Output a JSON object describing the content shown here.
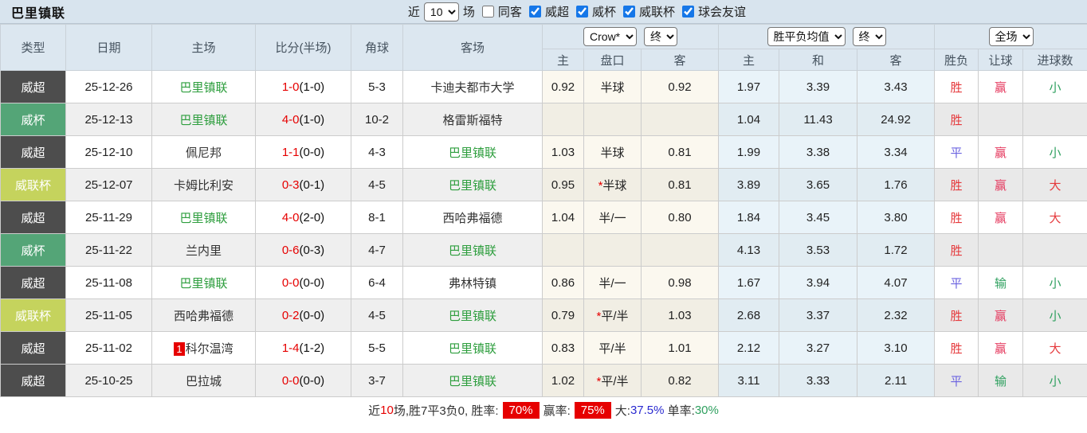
{
  "title": "巴里镇联",
  "filters": {
    "near_label": "近",
    "near_value": "10",
    "games_label": "场",
    "same_opponent": {
      "label": "同客",
      "checked": false
    },
    "leagues": [
      {
        "label": "威超",
        "checked": true
      },
      {
        "label": "威杯",
        "checked": true
      },
      {
        "label": "威联杯",
        "checked": true
      },
      {
        "label": "球会友谊",
        "checked": true
      }
    ]
  },
  "table": {
    "main_headers": [
      "类型",
      "日期",
      "主场",
      "比分(半场)",
      "角球",
      "客场"
    ],
    "group_selects": {
      "ah_company": "Crow*",
      "ah_stage": "终",
      "eu_company": "胜平负均值",
      "eu_stage": "终",
      "scope": "全场"
    },
    "sub_headers": [
      "主",
      "盘口",
      "客",
      "主",
      "和",
      "客",
      "胜负",
      "让球",
      "进球数"
    ],
    "rows": [
      {
        "type": "威超",
        "type_style": "dark",
        "date": "25-12-26",
        "home": "巴里镇联",
        "home_is_team": true,
        "home_rank": "",
        "score": "1-0",
        "half": "(1-0)",
        "corner": "5-3",
        "away": "卡迪夫都市大学",
        "away_is_team": false,
        "ah_home": "0.92",
        "ah_star": false,
        "ah_line": "半球",
        "ah_away": "0.92",
        "odds_home": "1.97",
        "odds_draw": "3.39",
        "odds_away": "3.43",
        "result": "胜",
        "handicap": "赢",
        "goals": "小"
      },
      {
        "type": "威杯",
        "type_style": "green",
        "date": "25-12-13",
        "home": "巴里镇联",
        "home_is_team": true,
        "home_rank": "",
        "score": "4-0",
        "half": "(1-0)",
        "corner": "10-2",
        "away": "格雷斯福特",
        "away_is_team": false,
        "ah_home": "",
        "ah_star": false,
        "ah_line": "",
        "ah_away": "",
        "odds_home": "1.04",
        "odds_draw": "11.43",
        "odds_away": "24.92",
        "result": "胜",
        "handicap": "",
        "goals": ""
      },
      {
        "type": "威超",
        "type_style": "dark",
        "date": "25-12-10",
        "home": "佩尼邦",
        "home_is_team": false,
        "home_rank": "",
        "score": "1-1",
        "half": "(0-0)",
        "corner": "4-3",
        "away": "巴里镇联",
        "away_is_team": true,
        "ah_home": "1.03",
        "ah_star": false,
        "ah_line": "半球",
        "ah_away": "0.81",
        "odds_home": "1.99",
        "odds_draw": "3.38",
        "odds_away": "3.34",
        "result": "平",
        "handicap": "赢",
        "goals": "小"
      },
      {
        "type": "威联杯",
        "type_style": "yellowgreen",
        "date": "25-12-07",
        "home": "卡姆比利安",
        "home_is_team": false,
        "home_rank": "",
        "score": "0-3",
        "half": "(0-1)",
        "corner": "4-5",
        "away": "巴里镇联",
        "away_is_team": true,
        "ah_home": "0.95",
        "ah_star": true,
        "ah_line": "半球",
        "ah_away": "0.81",
        "odds_home": "3.89",
        "odds_draw": "3.65",
        "odds_away": "1.76",
        "result": "胜",
        "handicap": "赢",
        "goals": "大"
      },
      {
        "type": "威超",
        "type_style": "dark",
        "date": "25-11-29",
        "home": "巴里镇联",
        "home_is_team": true,
        "home_rank": "",
        "score": "4-0",
        "half": "(2-0)",
        "corner": "8-1",
        "away": "西哈弗福德",
        "away_is_team": false,
        "ah_home": "1.04",
        "ah_star": false,
        "ah_line": "半/一",
        "ah_away": "0.80",
        "odds_home": "1.84",
        "odds_draw": "3.45",
        "odds_away": "3.80",
        "result": "胜",
        "handicap": "赢",
        "goals": "大"
      },
      {
        "type": "威杯",
        "type_style": "green",
        "date": "25-11-22",
        "home": "兰内里",
        "home_is_team": false,
        "home_rank": "",
        "score": "0-6",
        "half": "(0-3)",
        "corner": "4-7",
        "away": "巴里镇联",
        "away_is_team": true,
        "ah_home": "",
        "ah_star": false,
        "ah_line": "",
        "ah_away": "",
        "odds_home": "4.13",
        "odds_draw": "3.53",
        "odds_away": "1.72",
        "result": "胜",
        "handicap": "",
        "goals": ""
      },
      {
        "type": "威超",
        "type_style": "dark",
        "date": "25-11-08",
        "home": "巴里镇联",
        "home_is_team": true,
        "home_rank": "",
        "score": "0-0",
        "half": "(0-0)",
        "corner": "6-4",
        "away": "弗林特镇",
        "away_is_team": false,
        "ah_home": "0.86",
        "ah_star": false,
        "ah_line": "半/一",
        "ah_away": "0.98",
        "odds_home": "1.67",
        "odds_draw": "3.94",
        "odds_away": "4.07",
        "result": "平",
        "handicap": "输",
        "goals": "小"
      },
      {
        "type": "威联杯",
        "type_style": "yellowgreen",
        "date": "25-11-05",
        "home": "西哈弗福德",
        "home_is_team": false,
        "home_rank": "",
        "score": "0-2",
        "half": "(0-0)",
        "corner": "4-5",
        "away": "巴里镇联",
        "away_is_team": true,
        "ah_home": "0.79",
        "ah_star": true,
        "ah_line": "平/半",
        "ah_away": "1.03",
        "odds_home": "2.68",
        "odds_draw": "3.37",
        "odds_away": "2.32",
        "result": "胜",
        "handicap": "赢",
        "goals": "小"
      },
      {
        "type": "威超",
        "type_style": "dark",
        "date": "25-11-02",
        "home": "科尔温湾",
        "home_is_team": false,
        "home_rank": "1",
        "score": "1-4",
        "half": "(1-2)",
        "corner": "5-5",
        "away": "巴里镇联",
        "away_is_team": true,
        "ah_home": "0.83",
        "ah_star": false,
        "ah_line": "平/半",
        "ah_away": "1.01",
        "odds_home": "2.12",
        "odds_draw": "3.27",
        "odds_away": "3.10",
        "result": "胜",
        "handicap": "赢",
        "goals": "大"
      },
      {
        "type": "威超",
        "type_style": "dark",
        "date": "25-10-25",
        "home": "巴拉城",
        "home_is_team": false,
        "home_rank": "",
        "score": "0-0",
        "half": "(0-0)",
        "corner": "3-7",
        "away": "巴里镇联",
        "away_is_team": true,
        "ah_home": "1.02",
        "ah_star": true,
        "ah_line": "平/半",
        "ah_away": "0.82",
        "odds_home": "3.11",
        "odds_draw": "3.33",
        "odds_away": "2.11",
        "result": "平",
        "handicap": "输",
        "goals": "小"
      }
    ]
  },
  "result_colors": {
    "胜": "#e5393c",
    "平": "#6b63e0",
    "负": "#2fa05f",
    "赢": "#e5395e",
    "输": "#2fa05f",
    "大": "#e5393c",
    "小": "#2fa05f"
  },
  "colors": {
    "team_green": "#2e9e3e",
    "score_red": "#e60000",
    "type_dark": "#4d4d4d",
    "type_green": "#54a577",
    "type_yellowgreen": "#c5d35d"
  },
  "footer": {
    "parts": [
      {
        "text": "近",
        "color": "#333333"
      },
      {
        "text": "10",
        "color": "#e60000"
      },
      {
        "text": "场,胜7平3负0, 胜率:",
        "color": "#333333"
      },
      {
        "text": "70%",
        "badge": true
      },
      {
        "text": "赢率:",
        "color": "#333333"
      },
      {
        "text": "75%",
        "badge": true
      },
      {
        "text": "大:",
        "color": "#333333"
      },
      {
        "text": "37.5%",
        "color": "#2a2ad0"
      },
      {
        "text": " 单率:",
        "color": "#333333"
      },
      {
        "text": "30%",
        "color": "#2fa05f"
      }
    ]
  }
}
